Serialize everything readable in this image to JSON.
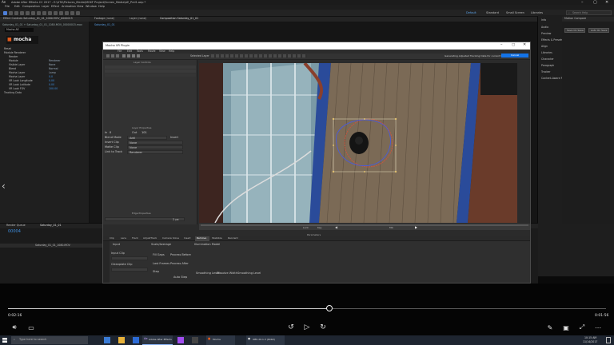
{
  "app": {
    "title": "Adobe After Effects CC 2017 - E:\\UTA\\Pictures_Media\\MOXF Project\\Screen_Media\\AE_Prel1.aep *",
    "menu": [
      "File",
      "Edit",
      "Composition",
      "Layer",
      "Effect",
      "Animation",
      "View",
      "Window",
      "Help"
    ],
    "workspace": [
      "Default",
      "Standard",
      "Small Screen",
      "Libraries"
    ],
    "search_placeholder": "Search Help"
  },
  "left_panel": {
    "tabs": [
      "Effect Controls Saturday_01_01_1080.MOV_0000015"
    ],
    "header": "Saturday_01_01 + Saturday_01_01_1080.MOV_00000015.mov",
    "effect_name": "Mocha AE",
    "logo": "mocha",
    "rows": [
      {
        "label": "Reset",
        "value": ""
      },
      {
        "label": "Module Renderer",
        "value": ""
      },
      {
        "label": "Render",
        "value": ""
      },
      {
        "label": "Module",
        "value": "Renderer"
      },
      {
        "label": "Visible Layer",
        "value": "None"
      },
      {
        "label": "Blend",
        "value": "Normal"
      },
      {
        "label": "Mocha Layer",
        "value": "Lamp"
      },
      {
        "label": "Mocha Layer",
        "value": "0.0"
      },
      {
        "label": "VR Look Longitude",
        "value": "0.00"
      },
      {
        "label": "VR Look Latitude",
        "value": "0.00"
      },
      {
        "label": "VR Look FOV",
        "value": "100.00"
      },
      {
        "label": "Tracking Data",
        "value": ""
      }
    ]
  },
  "comp_panel": {
    "tabs": [
      "Footage (none)",
      "Layer (none)",
      "Composition Saturday_01_01"
    ],
    "sub_tab": "Saturday_01_01"
  },
  "right_panel": {
    "tabs": [
      "Info",
      "Audio",
      "Preview",
      "Effects & Presets",
      "Align",
      "Libraries",
      "Character",
      "Paragraph",
      "Tracker",
      "Content-Aware Fill"
    ],
    "section": "Motion Compare",
    "buttons": [
      "Save On Save",
      "Auto On Save"
    ]
  },
  "timeline": {
    "tab": "Render Queue",
    "comp_tab": "Saturday_01_01",
    "timecode": "00004",
    "layer_name": "Saturday_01_01_1080.MOV"
  },
  "mocha": {
    "title": "Mocha VR Plugin",
    "menu": [
      "File",
      "Edit",
      "Tools",
      "Movie",
      "View",
      "Help"
    ],
    "layer_controls_label": "Layer Controls",
    "layer_props_label": "Layer Properties",
    "edge_props_label": "Edge Properties",
    "properties_label": "Parameters",
    "status": "Generating Adjusted Tracking Data for current frame.",
    "status_button": "Cancel",
    "selected_label": "Selected Layer",
    "layer_props": [
      {
        "label": "In",
        "value": "0"
      },
      {
        "label": "Out",
        "value": "101"
      },
      {
        "label": "Blend Mode",
        "value": "Add"
      },
      {
        "label": "Insert",
        "value": "Insert"
      },
      {
        "label": "Insert Clip",
        "value": "None"
      },
      {
        "label": "Matte Clip",
        "value": "None"
      },
      {
        "label": "Link to Track",
        "value": "Renderer"
      }
    ],
    "edge_value": "2 px",
    "viewer_controls": [
      "zoom",
      "pan",
      "play",
      "stop",
      "key"
    ],
    "viewer_text": [
      "Lock",
      "Key",
      "Min"
    ],
    "bottom_tabs": [
      "Clip",
      "Lens",
      "Track",
      "AdjustTrack",
      "Camera Solve",
      "Insert",
      "Remove",
      "Stabilize",
      "Reorient"
    ],
    "bottom_active": "Remove",
    "sections": {
      "input": "Input",
      "input_clip": "Input Clip",
      "clean_plate": "Cleanplate Clip",
      "scaling": "Scale/Average",
      "fill_gaps": "Fill Gaps",
      "layer_props": "Last Frames",
      "step": "Step",
      "auto_step": "Auto Step",
      "illumination": "Illumination Model",
      "smoothing": "Smoothing Level",
      "disolve": "Dissolve Width",
      "interp": "Interpolate",
      "process_before": "Process Before",
      "process_after": "Process After",
      "interp_options": "Smoothing Level"
    }
  },
  "player": {
    "current_time": "0:02:16",
    "total_time": "0:01:56",
    "progress": 0.537
  },
  "taskbar": {
    "search_placeholder": "Type here to search",
    "apps": [
      "Adobe After Effects",
      "Mocha",
      "OBS 20.1.3 (64bit)"
    ],
    "time": "10:15 AM",
    "date": "11/14/2017"
  },
  "colors": {
    "accent": "#1473e6",
    "spline_red": "#d8503a",
    "spline_blue": "#4a5bd8",
    "deck_wood": "#7b6a56",
    "hull_blue": "#2a4b9a"
  }
}
